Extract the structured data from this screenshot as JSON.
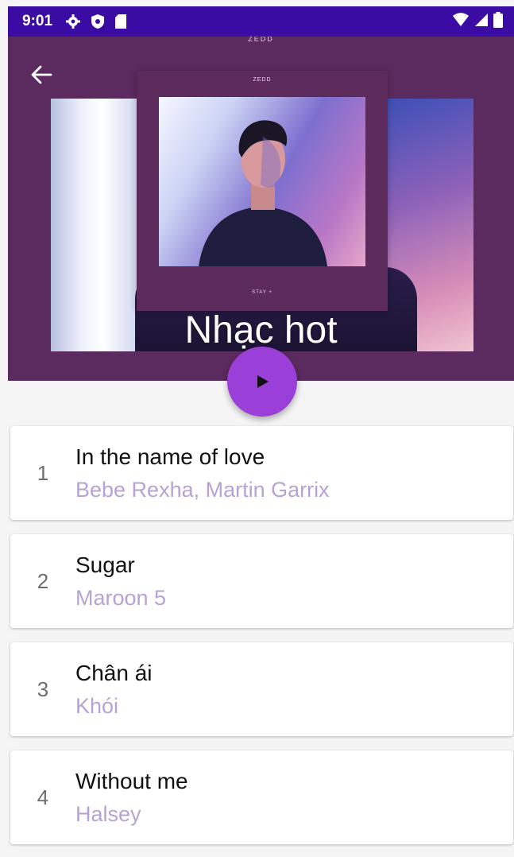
{
  "status_bar": {
    "time": "9:01",
    "icons": [
      "gear-icon",
      "shield-icon",
      "sd-card-icon"
    ],
    "right_icons": [
      "wifi-icon",
      "signal-icon",
      "battery-icon"
    ],
    "background": "#3a0ca3"
  },
  "header": {
    "title": "Nhạc hot",
    "back_icon": "arrow-left-icon",
    "background": "#5b2a5e",
    "album_label_top": "ZEDD",
    "album_label_inner": "ZEDD",
    "album_label_bottom": "STAY +"
  },
  "play_button": {
    "icon": "play-icon",
    "color": "#9b3fd9"
  },
  "songs": [
    {
      "index": "1",
      "title": "In the name of love",
      "artist": "Bebe Rexha, Martin Garrix"
    },
    {
      "index": "2",
      "title": "Sugar",
      "artist": "Maroon 5"
    },
    {
      "index": "3",
      "title": "Chân ái",
      "artist": "Khói"
    },
    {
      "index": "4",
      "title": "Without me",
      "artist": "Halsey"
    }
  ],
  "colors": {
    "artist_text": "#b7a2d6",
    "title_text": "#111111",
    "index_text": "#6e6e6e"
  }
}
